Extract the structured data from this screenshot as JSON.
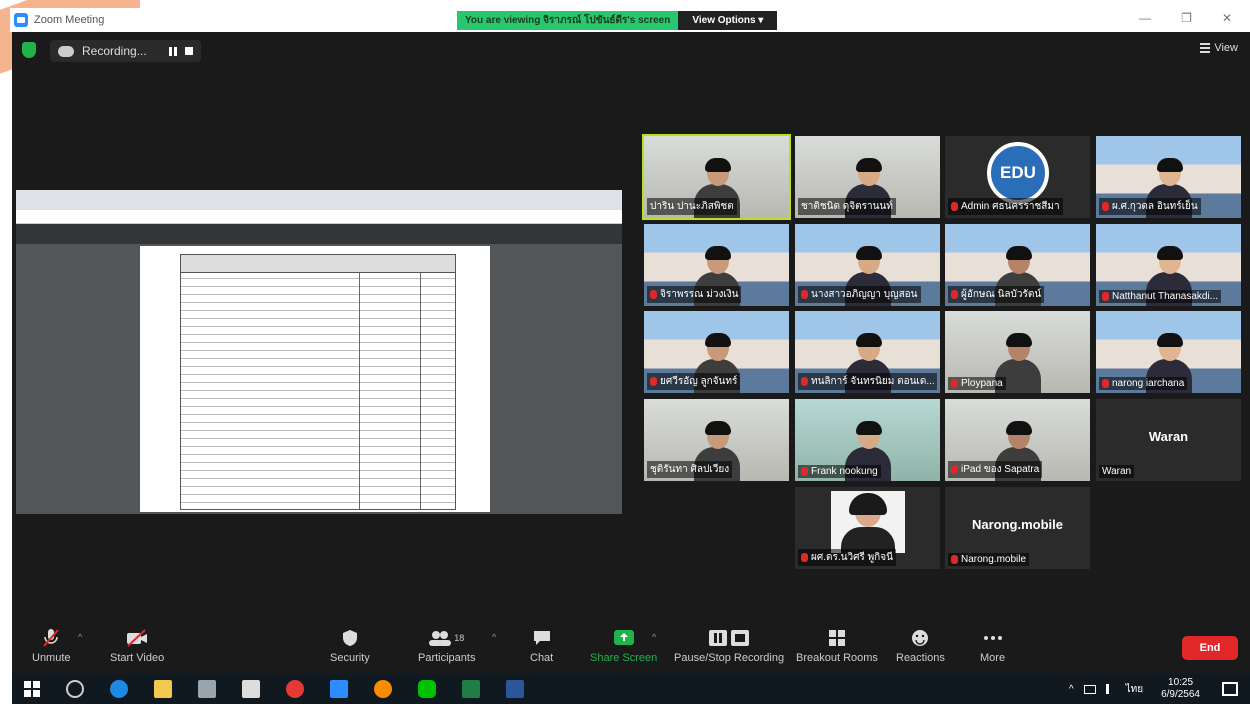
{
  "window": {
    "title": "Zoom Meeting",
    "viewing_banner": "You are viewing จิราภรณ์ โปขันธ์ดีร's screen",
    "view_options": "View Options",
    "controls": [
      "—",
      "❐",
      "✕"
    ]
  },
  "meeting": {
    "recording_label": "Recording...",
    "view_label": "View"
  },
  "participants": [
    {
      "name": "ปาริน ปานะภิสพิชต",
      "style": "office",
      "muted": false,
      "active": true
    },
    {
      "name": "ชาติชนิด ดุจิตรานนท์",
      "style": "office",
      "muted": false
    },
    {
      "name": "Admin ศธนครราชสีมา",
      "style": "logo",
      "muted": true,
      "logo_text": "EDU"
    },
    {
      "name": "ผ.ศ.กุวดล อินทร์เย็น",
      "style": "campus",
      "muted": true
    },
    {
      "name": "จิราพรรณ ม่วงเงิน",
      "style": "campus",
      "muted": true
    },
    {
      "name": "นางสาวอภิญญา บุญสอน",
      "style": "campus",
      "muted": true
    },
    {
      "name": "ผู้อักษณ นิลบัวรัตน์",
      "style": "campus",
      "muted": true
    },
    {
      "name": "Natthanut Thanasakdi...",
      "style": "campus",
      "muted": true
    },
    {
      "name": "ยศวีรอัญ ลูกจันทร์",
      "style": "campus",
      "muted": true
    },
    {
      "name": "ทนลิการ์ จันทรนิยม ตอนเด...",
      "style": "campus",
      "muted": true
    },
    {
      "name": "Ploypana",
      "style": "office",
      "muted": true
    },
    {
      "name": "narong iarchana",
      "style": "campus",
      "muted": true
    },
    {
      "name": "ชุติรันทา ศิลปเวียง",
      "style": "office",
      "muted": false
    },
    {
      "name": "Frank nookung",
      "style": "greenwall",
      "muted": true
    },
    {
      "name": "iPad ของ Sapatra",
      "style": "office",
      "muted": true
    },
    {
      "name": "Waran",
      "style": "blank",
      "muted": false,
      "big_name": "Waran"
    },
    {
      "name": "ผศ.ดร.นวิศรี พูกิจนี",
      "style": "portrait",
      "muted": true
    },
    {
      "name": "Narong.mobile",
      "style": "blank",
      "muted": true,
      "big_name": "Narong.mobile"
    }
  ],
  "toolbar": {
    "unmute": "Unmute",
    "start_video": "Start Video",
    "security": "Security",
    "participants": "Participants",
    "participants_count": "18",
    "chat": "Chat",
    "share_screen": "Share Screen",
    "pause_stop_recording": "Pause/Stop Recording",
    "breakout_rooms": "Breakout Rooms",
    "reactions": "Reactions",
    "more": "More",
    "end": "End"
  },
  "taskbar": {
    "time": "10:25",
    "date": "6/9/2564",
    "lang": "ไทย"
  },
  "colors": {
    "banner_green": "#28c76f",
    "active_speaker": "#b6e11d",
    "end_red": "#e02828",
    "share_green": "#21b34a"
  }
}
